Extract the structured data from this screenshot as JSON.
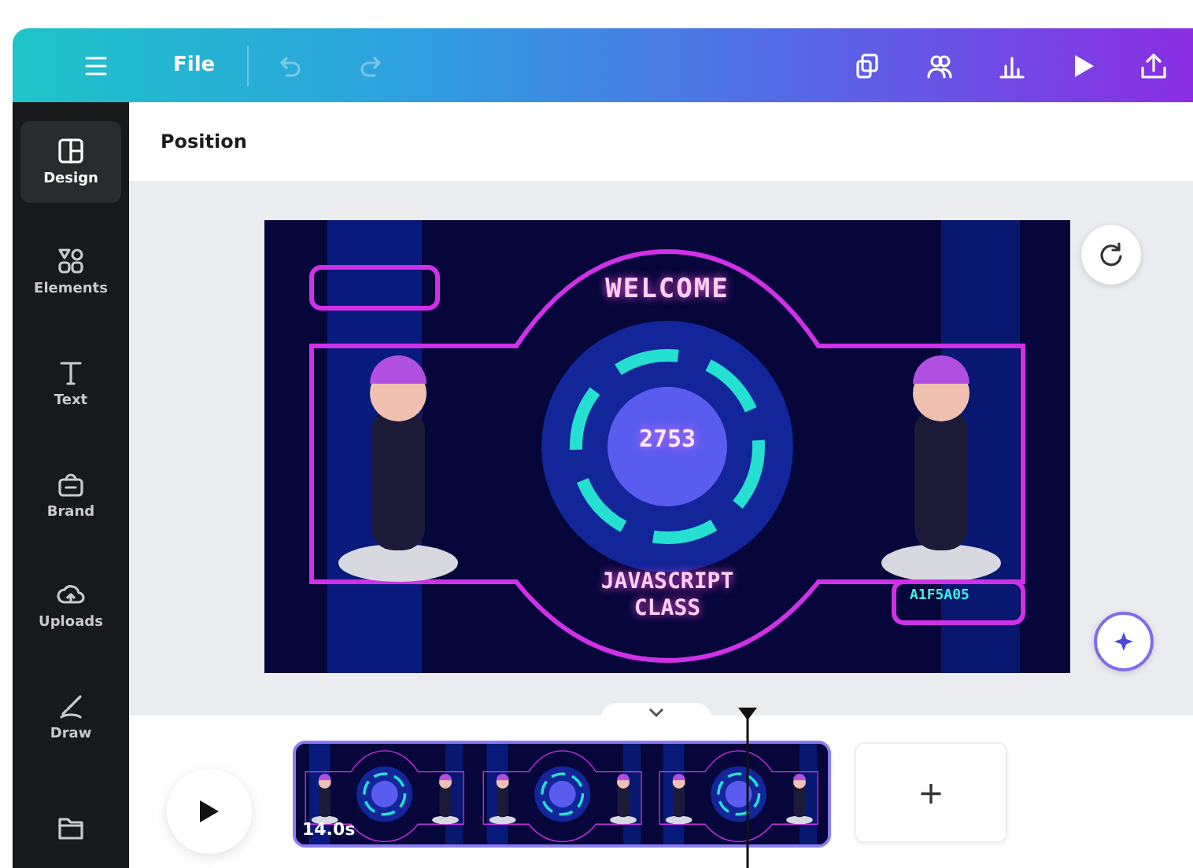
{
  "toolbar": {
    "file_label": "File",
    "undo": {
      "disabled": true
    },
    "redo": {
      "disabled": true
    },
    "actions": [
      {
        "kind": "resize"
      },
      {
        "kind": "people"
      },
      {
        "kind": "chart"
      },
      {
        "kind": "present"
      },
      {
        "kind": "share"
      }
    ]
  },
  "sidebar": {
    "items": [
      {
        "kind": "design",
        "label": "Design",
        "selected": true
      },
      {
        "kind": "elements",
        "label": "Elements",
        "selected": false
      },
      {
        "kind": "text",
        "label": "Text",
        "selected": false
      },
      {
        "kind": "brand",
        "label": "Brand",
        "selected": false
      },
      {
        "kind": "uploads",
        "label": "Uploads",
        "selected": false
      },
      {
        "kind": "draw",
        "label": "Draw",
        "selected": false
      },
      {
        "kind": "folder",
        "selected": false
      }
    ]
  },
  "context_bar": {
    "label": "Position"
  },
  "design": {
    "title": "WELCOME",
    "counter": "2753",
    "subtitle": [
      "JAVASCRIPT",
      "CLASS"
    ],
    "code": "A1F5A05"
  },
  "timeline": {
    "duration": "14.0s",
    "add_label": "+"
  }
}
